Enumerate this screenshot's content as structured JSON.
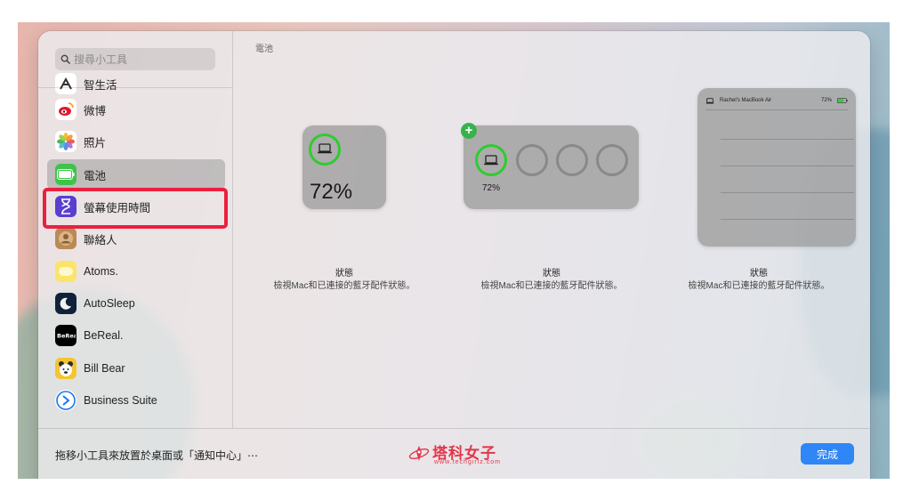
{
  "search": {
    "placeholder": "搜尋小工具"
  },
  "sidebar": {
    "items": [
      {
        "label": "智生活",
        "icon": "smart-life-icon"
      },
      {
        "label": "微博",
        "icon": "weibo-icon"
      },
      {
        "label": "照片",
        "icon": "photos-icon"
      },
      {
        "label": "電池",
        "icon": "battery-icon",
        "selected": true
      },
      {
        "label": "螢幕使用時間",
        "icon": "screen-time-icon"
      },
      {
        "label": "聯絡人",
        "icon": "contacts-icon"
      },
      {
        "label": "Atoms.",
        "icon": "atoms-icon"
      },
      {
        "label": "AutoSleep",
        "icon": "autosleep-icon"
      },
      {
        "label": "BeReal.",
        "icon": "bereal-icon"
      },
      {
        "label": "Bill Bear",
        "icon": "bill-bear-icon"
      },
      {
        "label": "Business Suite",
        "icon": "business-suite-icon"
      }
    ]
  },
  "main": {
    "title": "電池",
    "widgets": [
      {
        "size": "small",
        "percent": "72%",
        "caption_title": "狀態",
        "caption_desc": "檢視Mac和已連接的藍牙配件狀態。"
      },
      {
        "size": "medium",
        "percent": "72%",
        "caption_title": "狀態",
        "caption_desc": "檢視Mac和已連接的藍牙配件狀態。"
      },
      {
        "size": "large",
        "device_name": "Rachel's MacBook Air",
        "percent": "72%",
        "caption_title": "狀態",
        "caption_desc": "檢視Mac和已連接的藍牙配件狀態。"
      }
    ],
    "battery_level": 0.72
  },
  "footer": {
    "hint": "拖移小工具來放置於桌面或「通知中心」⋯",
    "done_label": "完成",
    "watermark": "塔科女子",
    "watermark_url": "www.techgirlz.com"
  },
  "colors": {
    "accent": "#2f86f6",
    "ring_green": "#2ecc2e",
    "highlight": "#ec1f3f"
  }
}
